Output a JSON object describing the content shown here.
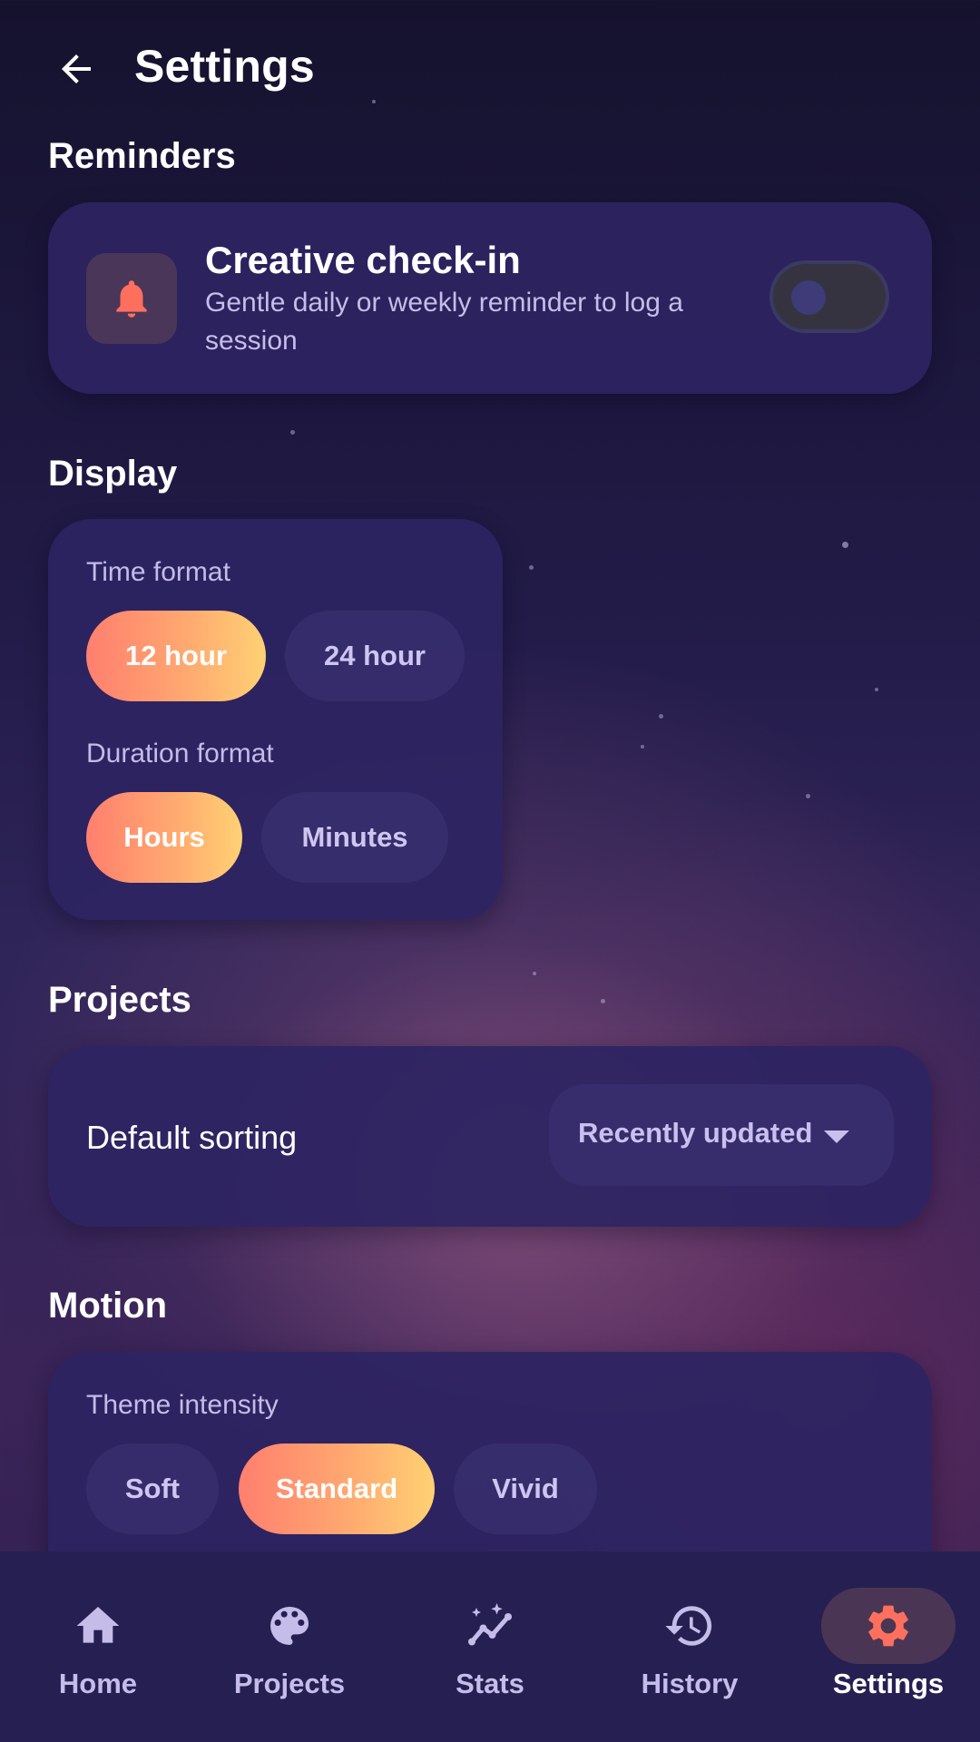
{
  "header": {
    "title": "Settings",
    "back_icon": "arrow-left-icon"
  },
  "sections": {
    "reminders": {
      "title": "Reminders",
      "item": {
        "icon": "bell-icon",
        "title": "Creative check-in",
        "description": "Gentle daily or weekly reminder to log a session",
        "enabled": false
      }
    },
    "display": {
      "title": "Display",
      "time_format": {
        "label": "Time format",
        "options": [
          "12 hour",
          "24 hour"
        ],
        "selected": "12 hour"
      },
      "duration_format": {
        "label": "Duration format",
        "options": [
          "Hours",
          "Minutes"
        ],
        "selected": "Hours"
      }
    },
    "projects": {
      "title": "Projects",
      "default_sorting": {
        "label": "Default sorting",
        "value": "Recently updated"
      }
    },
    "motion": {
      "title": "Motion",
      "theme_intensity": {
        "label": "Theme intensity",
        "options": [
          "Soft",
          "Standard",
          "Vivid"
        ],
        "selected": "Standard"
      }
    }
  },
  "bottom_nav": {
    "items": [
      {
        "label": "Home",
        "icon": "home-icon"
      },
      {
        "label": "Projects",
        "icon": "palette-icon"
      },
      {
        "label": "Stats",
        "icon": "stats-icon"
      },
      {
        "label": "History",
        "icon": "history-icon"
      },
      {
        "label": "Settings",
        "icon": "gear-icon"
      }
    ],
    "active": "Settings"
  },
  "colors": {
    "accent_gradient_start": "#ff7f6e",
    "accent_gradient_end": "#ffd173",
    "bell": "#ff6f5e",
    "active_nav": "#ff6f5e"
  }
}
